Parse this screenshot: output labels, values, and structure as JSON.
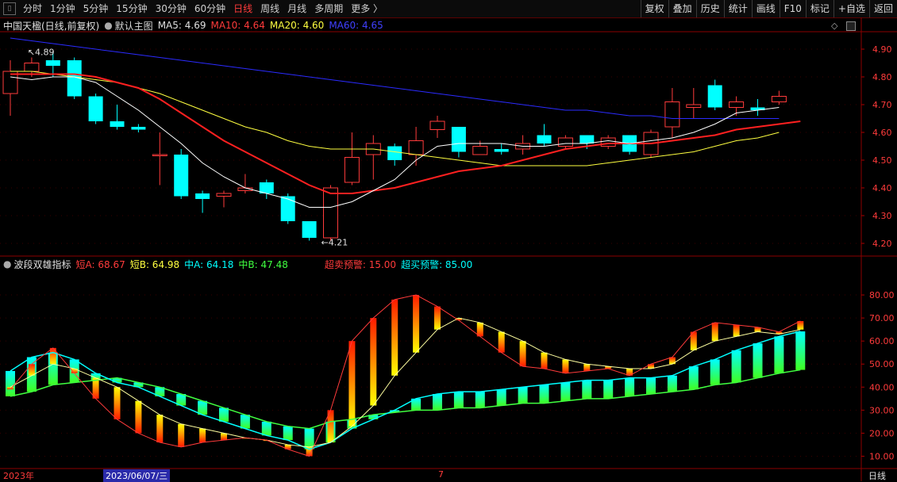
{
  "toolbar": {
    "periods": [
      {
        "label": "分时",
        "active": false
      },
      {
        "label": "1分钟",
        "active": false
      },
      {
        "label": "5分钟",
        "active": false
      },
      {
        "label": "15分钟",
        "active": false
      },
      {
        "label": "30分钟",
        "active": false
      },
      {
        "label": "60分钟",
        "active": false
      },
      {
        "label": "日线",
        "active": true
      },
      {
        "label": "周线",
        "active": false
      },
      {
        "label": "月线",
        "active": false
      },
      {
        "label": "多周期",
        "active": false
      },
      {
        "label": "更多 〉",
        "active": false
      }
    ],
    "tools": [
      "复权",
      "叠加",
      "历史",
      "统计",
      "画线",
      "F10",
      "标记",
      "+自选",
      "返回"
    ]
  },
  "main_legend": {
    "stock": "中国天楹(日线,前复权)",
    "template": "默认主图",
    "ma5": "MA5: 4.69",
    "ma10": "MA10: 4.64",
    "ma20": "MA20: 4.60",
    "ma60": "MA60: 4.65"
  },
  "sub_legend": {
    "name": "波段双雄指标",
    "shortA": "短A: 68.67",
    "shortB": "短B: 64.98",
    "midA": "中A: 64.18",
    "midB": "中B: 47.48",
    "oversell": "超卖预警: 15.00",
    "overbuy": "超买预警: 85.00"
  },
  "xaxis": {
    "year_label": "2023年",
    "cursor_date": "2023/06/07/三",
    "month_label": "7",
    "period_label": "日线"
  },
  "colors": {
    "up": "#ff3b3b",
    "down": "#00ffff",
    "ma5": "#ffffff",
    "ma10": "#ff2020",
    "ma20": "#ffff40",
    "ma60": "#2b2bff",
    "grid": "#8b0000"
  },
  "chart_data": [
    {
      "type": "candlestick",
      "title": "中国天楹(日线,前复权)",
      "ylim": [
        4.16,
        4.96
      ],
      "yticks": [
        "4.90",
        "4.80",
        "4.70",
        "4.60",
        "4.50",
        "4.40",
        "4.30",
        "4.20"
      ],
      "annotations": [
        {
          "label": "4.89",
          "index": 2
        },
        {
          "label": "4.21",
          "index": 15
        }
      ],
      "candles": [
        [
          4.74,
          4.82,
          4.86,
          4.66
        ],
        [
          4.82,
          4.85,
          4.87,
          4.8
        ],
        [
          4.86,
          4.84,
          4.89,
          4.8
        ],
        [
          4.86,
          4.73,
          4.87,
          4.72
        ],
        [
          4.73,
          4.64,
          4.74,
          4.63
        ],
        [
          4.64,
          4.62,
          4.7,
          4.61
        ],
        [
          4.62,
          4.61,
          4.63,
          4.6
        ],
        [
          4.52,
          4.52,
          4.6,
          4.41
        ],
        [
          4.52,
          4.37,
          4.54,
          4.36
        ],
        [
          4.38,
          4.36,
          4.39,
          4.31
        ],
        [
          4.37,
          4.38,
          4.39,
          4.33
        ],
        [
          4.39,
          4.4,
          4.45,
          4.38
        ],
        [
          4.42,
          4.38,
          4.43,
          4.36
        ],
        [
          4.37,
          4.28,
          4.38,
          4.27
        ],
        [
          4.28,
          4.22,
          4.28,
          4.21
        ],
        [
          4.22,
          4.4,
          4.41,
          4.21
        ],
        [
          4.42,
          4.51,
          4.6,
          4.41
        ],
        [
          4.52,
          4.56,
          4.59,
          4.43
        ],
        [
          4.55,
          4.5,
          4.56,
          4.48
        ],
        [
          4.52,
          4.57,
          4.62,
          4.48
        ],
        [
          4.61,
          4.64,
          4.66,
          4.58
        ],
        [
          4.62,
          4.53,
          4.62,
          4.51
        ],
        [
          4.52,
          4.55,
          4.57,
          4.52
        ],
        [
          4.54,
          4.53,
          4.56,
          4.52
        ],
        [
          4.54,
          4.56,
          4.59,
          4.52
        ],
        [
          4.59,
          4.56,
          4.63,
          4.55
        ],
        [
          4.55,
          4.58,
          4.59,
          4.54
        ],
        [
          4.59,
          4.56,
          4.59,
          4.54
        ],
        [
          4.55,
          4.58,
          4.59,
          4.54
        ],
        [
          4.59,
          4.53,
          4.59,
          4.52
        ],
        [
          4.52,
          4.6,
          4.61,
          4.51
        ],
        [
          4.62,
          4.71,
          4.76,
          4.58
        ],
        [
          4.69,
          4.7,
          4.76,
          4.65
        ],
        [
          4.77,
          4.69,
          4.79,
          4.68
        ],
        [
          4.69,
          4.71,
          4.73,
          4.66
        ],
        [
          4.69,
          4.68,
          4.72,
          4.66
        ],
        [
          4.71,
          4.73,
          4.75,
          4.7
        ]
      ],
      "ma5": [
        4.8,
        4.79,
        4.8,
        4.8,
        4.78,
        4.73,
        4.68,
        4.62,
        4.56,
        4.49,
        4.44,
        4.4,
        4.38,
        4.36,
        4.33,
        4.33,
        4.35,
        4.39,
        4.43,
        4.5,
        4.55,
        4.56,
        4.56,
        4.56,
        4.55,
        4.55,
        4.56,
        4.56,
        4.57,
        4.56,
        4.57,
        4.58,
        4.6,
        4.63,
        4.67,
        4.68,
        4.69
      ],
      "ma10": [
        4.81,
        4.81,
        4.81,
        4.81,
        4.8,
        4.78,
        4.76,
        4.72,
        4.67,
        4.62,
        4.57,
        4.53,
        4.49,
        4.45,
        4.41,
        4.38,
        4.38,
        4.39,
        4.4,
        4.42,
        4.44,
        4.46,
        4.47,
        4.48,
        4.5,
        4.52,
        4.54,
        4.55,
        4.56,
        4.56,
        4.56,
        4.57,
        4.58,
        4.59,
        4.61,
        4.62,
        4.63,
        4.64
      ],
      "ma20": [
        4.82,
        4.82,
        4.81,
        4.8,
        4.79,
        4.78,
        4.76,
        4.74,
        4.71,
        4.68,
        4.65,
        4.62,
        4.6,
        4.57,
        4.55,
        4.54,
        4.54,
        4.54,
        4.53,
        4.52,
        4.51,
        4.5,
        4.49,
        4.48,
        4.48,
        4.48,
        4.48,
        4.48,
        4.49,
        4.5,
        4.51,
        4.52,
        4.53,
        4.55,
        4.57,
        4.58,
        4.6
      ],
      "ma60": [
        4.94,
        4.93,
        4.92,
        4.91,
        4.9,
        4.89,
        4.88,
        4.87,
        4.86,
        4.85,
        4.84,
        4.83,
        4.82,
        4.81,
        4.8,
        4.79,
        4.78,
        4.77,
        4.76,
        4.75,
        4.74,
        4.73,
        4.72,
        4.71,
        4.7,
        4.69,
        4.68,
        4.68,
        4.67,
        4.66,
        4.66,
        4.65,
        4.65,
        4.65,
        4.65,
        4.65,
        4.65
      ]
    },
    {
      "type": "indicator",
      "title": "波段双雄指标",
      "ylim": [
        5,
        90
      ],
      "yticks": [
        "80.00",
        "70.00",
        "60.00",
        "50.00",
        "40.00",
        "30.00",
        "20.00",
        "10.00"
      ],
      "series": [
        {
          "name": "短A",
          "values": [
            39,
            50,
            57,
            46,
            35,
            26,
            20,
            16,
            14,
            16,
            17,
            18,
            17,
            13,
            10,
            30,
            60,
            70,
            78,
            80,
            75,
            69,
            62,
            55,
            49,
            48,
            46,
            47,
            48,
            45,
            50,
            53,
            64,
            68,
            67,
            66,
            64,
            68.67
          ]
        },
        {
          "name": "短B",
          "values": [
            40,
            45,
            50,
            48,
            44,
            40,
            34,
            28,
            24,
            22,
            20,
            18,
            17,
            15,
            14,
            16,
            23,
            32,
            45,
            55,
            65,
            70,
            68,
            64,
            60,
            55,
            52,
            50,
            49,
            48,
            48,
            50,
            56,
            60,
            62,
            64,
            63,
            64.98
          ]
        },
        {
          "name": "中A",
          "values": [
            47,
            53,
            55,
            52,
            46,
            42,
            40,
            36,
            32,
            28,
            25,
            22,
            19,
            17,
            13,
            16,
            22,
            26,
            30,
            35,
            37,
            38,
            38,
            39,
            40,
            41,
            42,
            43,
            43,
            44,
            44,
            45,
            49,
            52,
            56,
            59,
            62,
            64.18
          ]
        },
        {
          "name": "中B",
          "values": [
            36,
            38,
            41,
            42,
            43,
            44,
            42,
            40,
            37,
            34,
            31,
            28,
            25,
            23,
            22,
            25,
            26,
            28,
            29,
            30,
            30,
            31,
            31,
            32,
            33,
            33,
            34,
            35,
            35,
            36,
            37,
            38,
            39,
            41,
            42,
            44,
            46,
            47.48
          ]
        }
      ]
    }
  ]
}
